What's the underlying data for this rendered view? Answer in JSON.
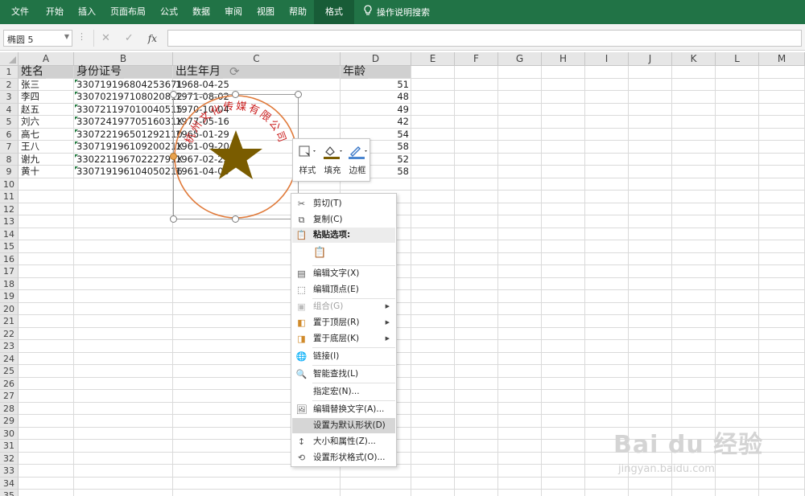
{
  "ribbon": {
    "tabs": [
      "文件",
      "开始",
      "插入",
      "页面布局",
      "公式",
      "数据",
      "审阅",
      "视图",
      "帮助",
      "格式"
    ],
    "active_tab": "格式",
    "tell_me": "操作说明搜索"
  },
  "formula_bar": {
    "name_box": "椭圆 5",
    "fx": "fx",
    "content": ""
  },
  "columns": [
    "A",
    "B",
    "C",
    "D",
    "E",
    "F",
    "G",
    "H",
    "I",
    "J",
    "K",
    "L",
    "M"
  ],
  "rows": [
    "1",
    "2",
    "3",
    "4",
    "5",
    "6",
    "7",
    "8",
    "9",
    "10",
    "11",
    "12",
    "13",
    "14",
    "15",
    "16",
    "17",
    "18",
    "19",
    "20",
    "21",
    "22",
    "23",
    "24",
    "25",
    "26",
    "27",
    "28",
    "29",
    "30",
    "31",
    "32",
    "33",
    "34",
    "35"
  ],
  "headers": {
    "a": "姓名",
    "b": "身份证号",
    "c": "出生年月",
    "d": "年龄"
  },
  "data_rows": [
    {
      "name": "张三",
      "id": "330719196804253671",
      "birth": "1968-04-25",
      "age": "51"
    },
    {
      "name": "李四",
      "id": "330702197108020812",
      "birth": "1971-08-02",
      "age": "48"
    },
    {
      "name": "赵五",
      "id": "330721197010040515",
      "birth": "1970-10-04",
      "age": "49"
    },
    {
      "name": "刘六",
      "id": "33072419770516031X",
      "birth": "1977-05-16",
      "age": "42"
    },
    {
      "name": "高七",
      "id": "330722196501292110",
      "birth": "1965-01-29",
      "age": "54"
    },
    {
      "name": "王八",
      "id": "33071919610920021X",
      "birth": "1961-09-20",
      "age": "58"
    },
    {
      "name": "谢九",
      "id": "33022119670222791X",
      "birth": "1967-02-22",
      "age": "52"
    },
    {
      "name": "黄十",
      "id": "330719196104050216",
      "birth": "1961-04-05",
      "age": "58"
    }
  ],
  "stamp": {
    "text": "杭州文化传媒有限公司",
    "ring_color": "#e07a3a",
    "text_color": "#cc2222",
    "star_color": "#7a5c00"
  },
  "mini_toolbar": {
    "style": "样式",
    "fill": "填充",
    "border": "边框"
  },
  "context_menu": {
    "cut": "剪切(T)",
    "copy": "复制(C)",
    "paste_options": "粘贴选项:",
    "edit_text": "编辑文字(X)",
    "edit_points": "编辑顶点(E)",
    "group": "组合(G)",
    "bring_front": "置于顶层(R)",
    "send_back": "置于底层(K)",
    "link": "链接(I)",
    "smart_lookup": "智能查找(L)",
    "assign_macro": "指定宏(N)...",
    "alt_text": "编辑替换文字(A)...",
    "set_default": "设置为默认形状(D)",
    "size_props": "大小和属性(Z)...",
    "format_shape": "设置形状格式(O)..."
  },
  "watermark": {
    "logo": "Bai du 经验",
    "url": "jingyan.baidu.com"
  }
}
